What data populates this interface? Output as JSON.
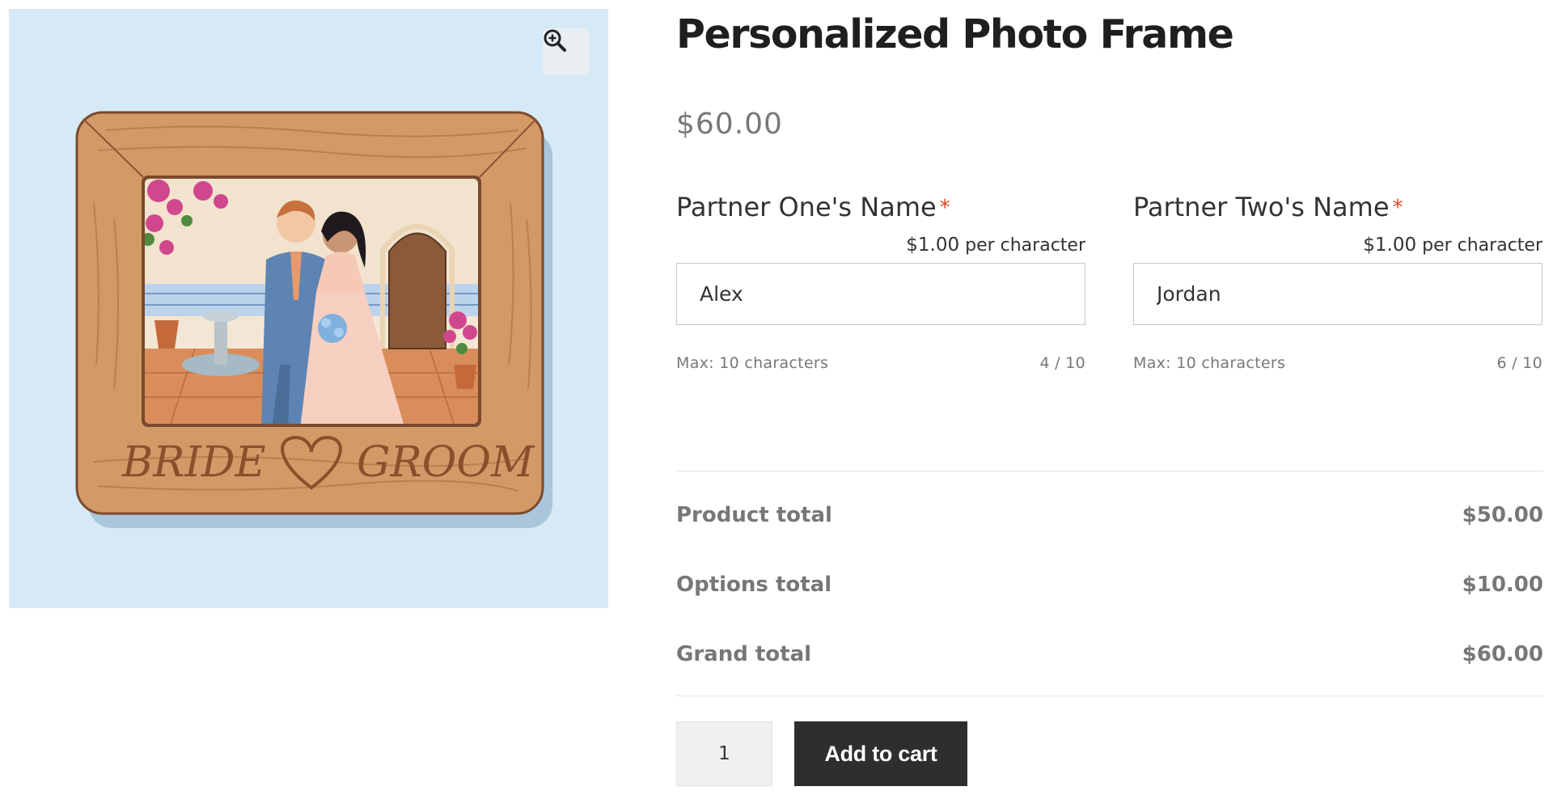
{
  "product": {
    "title": "Personalized Photo Frame",
    "price": "$60.00",
    "image_alt": "Wooden photo frame engraved Bride & Groom",
    "frame_engraving": {
      "left": "BRIDE",
      "right": "GROOM"
    }
  },
  "gallery": {
    "zoom_icon": "zoom-in-icon"
  },
  "fields": [
    {
      "label": "Partner One's Name",
      "required_mark": "*",
      "price_amount": "$1.00",
      "price_suffix": "per character",
      "value": "Alex",
      "max_text": "Max: 10 characters",
      "counter": "4 / 10"
    },
    {
      "label": "Partner Two's Name",
      "required_mark": "*",
      "price_amount": "$1.00",
      "price_suffix": "per character",
      "value": "Jordan",
      "max_text": "Max: 10 characters",
      "counter": "6 / 10"
    }
  ],
  "totals": {
    "product_label": "Product total",
    "product_value": "$50.00",
    "options_label": "Options total",
    "options_value": "$10.00",
    "grand_label": "Grand total",
    "grand_value": "$60.00"
  },
  "cart": {
    "quantity": "1",
    "add_label": "Add to cart"
  },
  "colors": {
    "gallery_bg": "#d6e9f6",
    "required": "#d9471e",
    "button_bg": "#2e2e2e",
    "frame_wood": "#d39a68"
  }
}
